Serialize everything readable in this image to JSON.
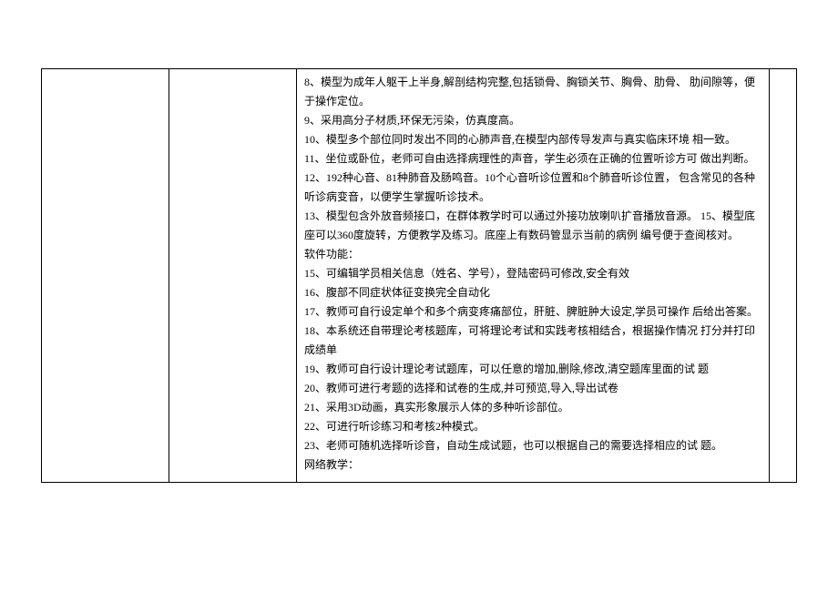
{
  "lines": [
    "8、模型为成年人躯干上半身,解剖结构完整,包括锁骨、胸锁关节、胸骨、肋骨、 肋间隙等，便于操作定位。",
    "9、采用高分子材质,环保无污染，仿真度高。",
    "10、模型多个部位同时发出不同的心肺声音,在模型内部传导发声与真实临床环境 相一致。",
    "11、坐位或卧位，老师可自由选择病理性的声音，学生必须在正确的位置听诊方可 做出判断。",
    "12、192种心音、81种肺音及肠鸣音。10个心音听诊位置和8个肺音听诊位置， 包含常见的各种听诊病变音，以便学生掌握听诊技术。",
    "13、模型包含外放音频接口，在群体教学时可以通过外接功放喇叭扩音播放音源。 15、模型底座可以360度旋转，方便教学及练习。底座上有数码管显示当前的病例 编号便于查阅核对。",
    "软件功能：",
    "15、可编辑学员相关信息（姓名、学号），登陆密码可修改,安全有效",
    "16、腹部不同症状体征变换完全自动化",
    "17、教师可自行设定单个和多个病变疼痛部位，肝脏、脾脏肿大设定,学员可操作 后给出答案。",
    "18、本系统还自带理论考核题库，可将理论考试和实践考核相结合，根据操作情况 打分并打印成绩单",
    "19、教师可自行设计理论考试题库，可以任意的增加,删除,修改,清空题库里面的试 题",
    "20、教师可进行考题的选择和试卷的生成,并可预览,导入,导出试卷",
    "21、采用3D动画，真实形象展示人体的多种听诊部位。",
    "22、可进行听诊练习和考核2种模式。",
    "23、老师可随机选择听诊音，自动生成试题，也可以根据自己的需要选择相应的试 题。",
    "网络教学："
  ]
}
